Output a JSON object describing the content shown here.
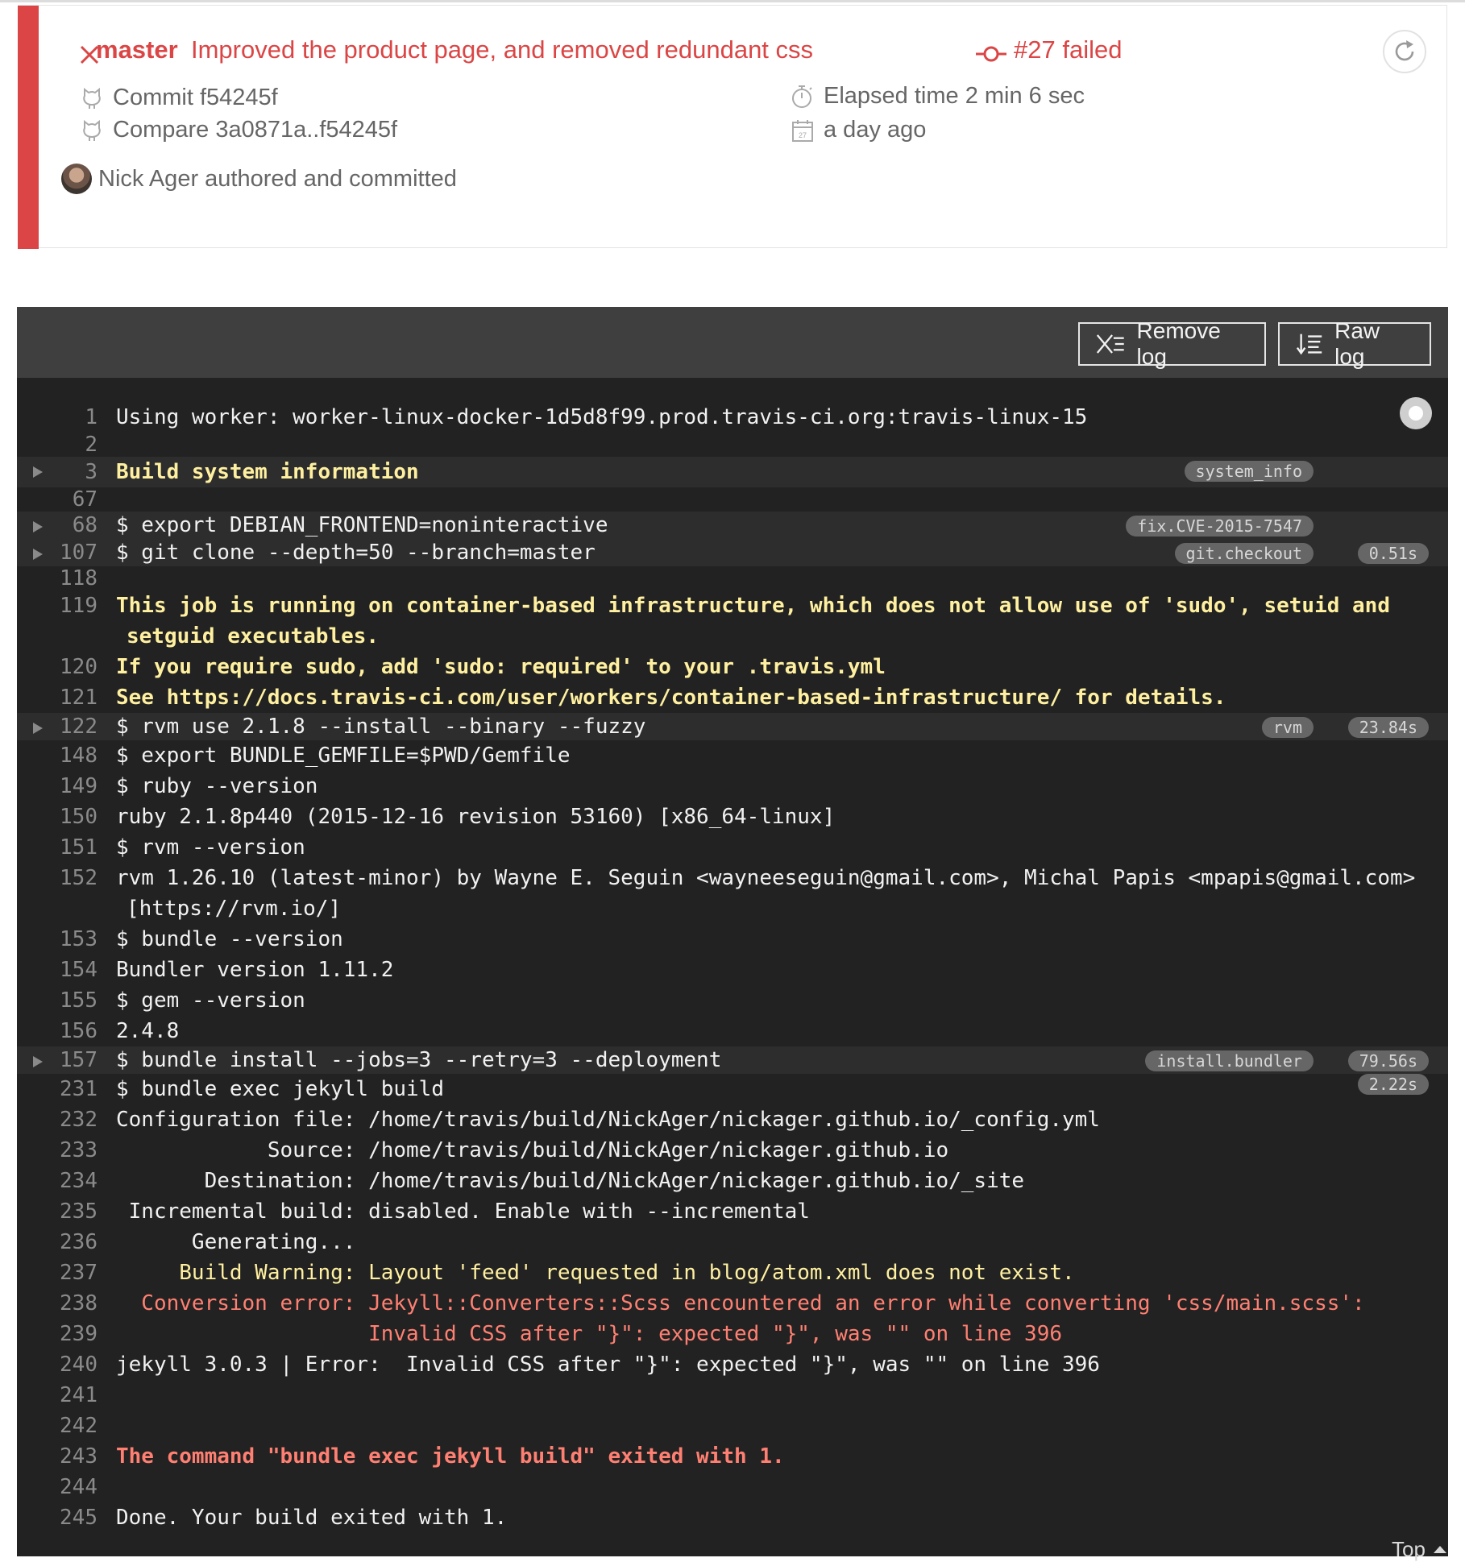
{
  "build": {
    "branch": "master",
    "commit_message": "Improved the product page, and removed redundant css",
    "status": "#27 failed",
    "commit": "Commit f54245f",
    "compare": "Compare 3a0871a..f54245f",
    "elapsed": "Elapsed time 2 min 6 sec",
    "date": "a day ago",
    "calendar_day": "27",
    "author": "Nick Ager authored and committed",
    "colors": {
      "failed": "#db4545"
    }
  },
  "toolbar": {
    "remove_log": "Remove log",
    "raw_log": "Raw log"
  },
  "log": {
    "lines": [
      {
        "n": "1",
        "text": "Using worker: worker-linux-docker-1d5d8f99.prod.travis-ci.org:travis-linux-15"
      },
      {
        "n": "2",
        "text": ""
      },
      {
        "n": "3",
        "text": "Build system information",
        "fold": "system_info"
      },
      {
        "n": "67",
        "text": ""
      },
      {
        "n": "68",
        "text": "$ export DEBIAN_FRONTEND=noninteractive",
        "fold": "fix.CVE-2015-7547"
      },
      {
        "n": "107",
        "text": "$ git clone --depth=50 --branch=master",
        "fold": "git.checkout",
        "time": "0.51s"
      },
      {
        "n": "118",
        "text": ""
      },
      {
        "n": "119",
        "text": "This job is running on container-based infrastructure, which does not allow use of 'sudo', setuid and setguid executables."
      },
      {
        "n": "120",
        "text": "If you require sudo, add 'sudo: required' to your .travis.yml"
      },
      {
        "n": "121",
        "text": "See https://docs.travis-ci.com/user/workers/container-based-infrastructure/ for details."
      },
      {
        "n": "122",
        "text": "$ rvm use 2.1.8 --install --binary --fuzzy",
        "fold": "rvm",
        "time": "23.84s"
      },
      {
        "n": "148",
        "text": "$ export BUNDLE_GEMFILE=$PWD/Gemfile"
      },
      {
        "n": "149",
        "text": "$ ruby --version"
      },
      {
        "n": "150",
        "text": "ruby 2.1.8p440 (2015-12-16 revision 53160) [x86_64-linux]"
      },
      {
        "n": "151",
        "text": "$ rvm --version"
      },
      {
        "n": "152",
        "text": "rvm 1.26.10 (latest-minor) by Wayne E. Seguin <wayneeseguin@gmail.com>, Michal Papis <mpapis@gmail.com> [https://rvm.io/]"
      },
      {
        "n": "153",
        "text": "$ bundle --version"
      },
      {
        "n": "154",
        "text": "Bundler version 1.11.2"
      },
      {
        "n": "155",
        "text": "$ gem --version"
      },
      {
        "n": "156",
        "text": "2.4.8"
      },
      {
        "n": "157",
        "text": "$ bundle install --jobs=3 --retry=3 --deployment",
        "fold": "install.bundler",
        "time": "79.56s"
      },
      {
        "n": "231",
        "text": "$ bundle exec jekyll build",
        "time": "2.22s"
      },
      {
        "n": "232",
        "text": "Configuration file: /home/travis/build/NickAger/nickager.github.io/_config.yml"
      },
      {
        "n": "233",
        "text": "            Source: /home/travis/build/NickAger/nickager.github.io"
      },
      {
        "n": "234",
        "text": "       Destination: /home/travis/build/NickAger/nickager.github.io/_site"
      },
      {
        "n": "235",
        "text": " Incremental build: disabled. Enable with --incremental"
      },
      {
        "n": "236",
        "text": "      Generating..."
      },
      {
        "n": "237",
        "text": "     Build Warning: Layout 'feed' requested in blog/atom.xml does not exist."
      },
      {
        "n": "238",
        "text": "  Conversion error: Jekyll::Converters::Scss encountered an error while converting 'css/main.scss':"
      },
      {
        "n": "239",
        "text": "                    Invalid CSS after \"}\": expected \"}\", was \"\" on line 396"
      },
      {
        "n": "240",
        "text": "jekyll 3.0.3 | Error:  Invalid CSS after \"}\": expected \"}\", was \"\" on line 396"
      },
      {
        "n": "241",
        "text": ""
      },
      {
        "n": "242",
        "text": ""
      },
      {
        "n": "243",
        "text": "The command \"bundle exec jekyll build\" exited with 1."
      },
      {
        "n": "244",
        "text": ""
      },
      {
        "n": "245",
        "text": "Done. Your build exited with 1."
      }
    ],
    "top_link": "Top"
  }
}
